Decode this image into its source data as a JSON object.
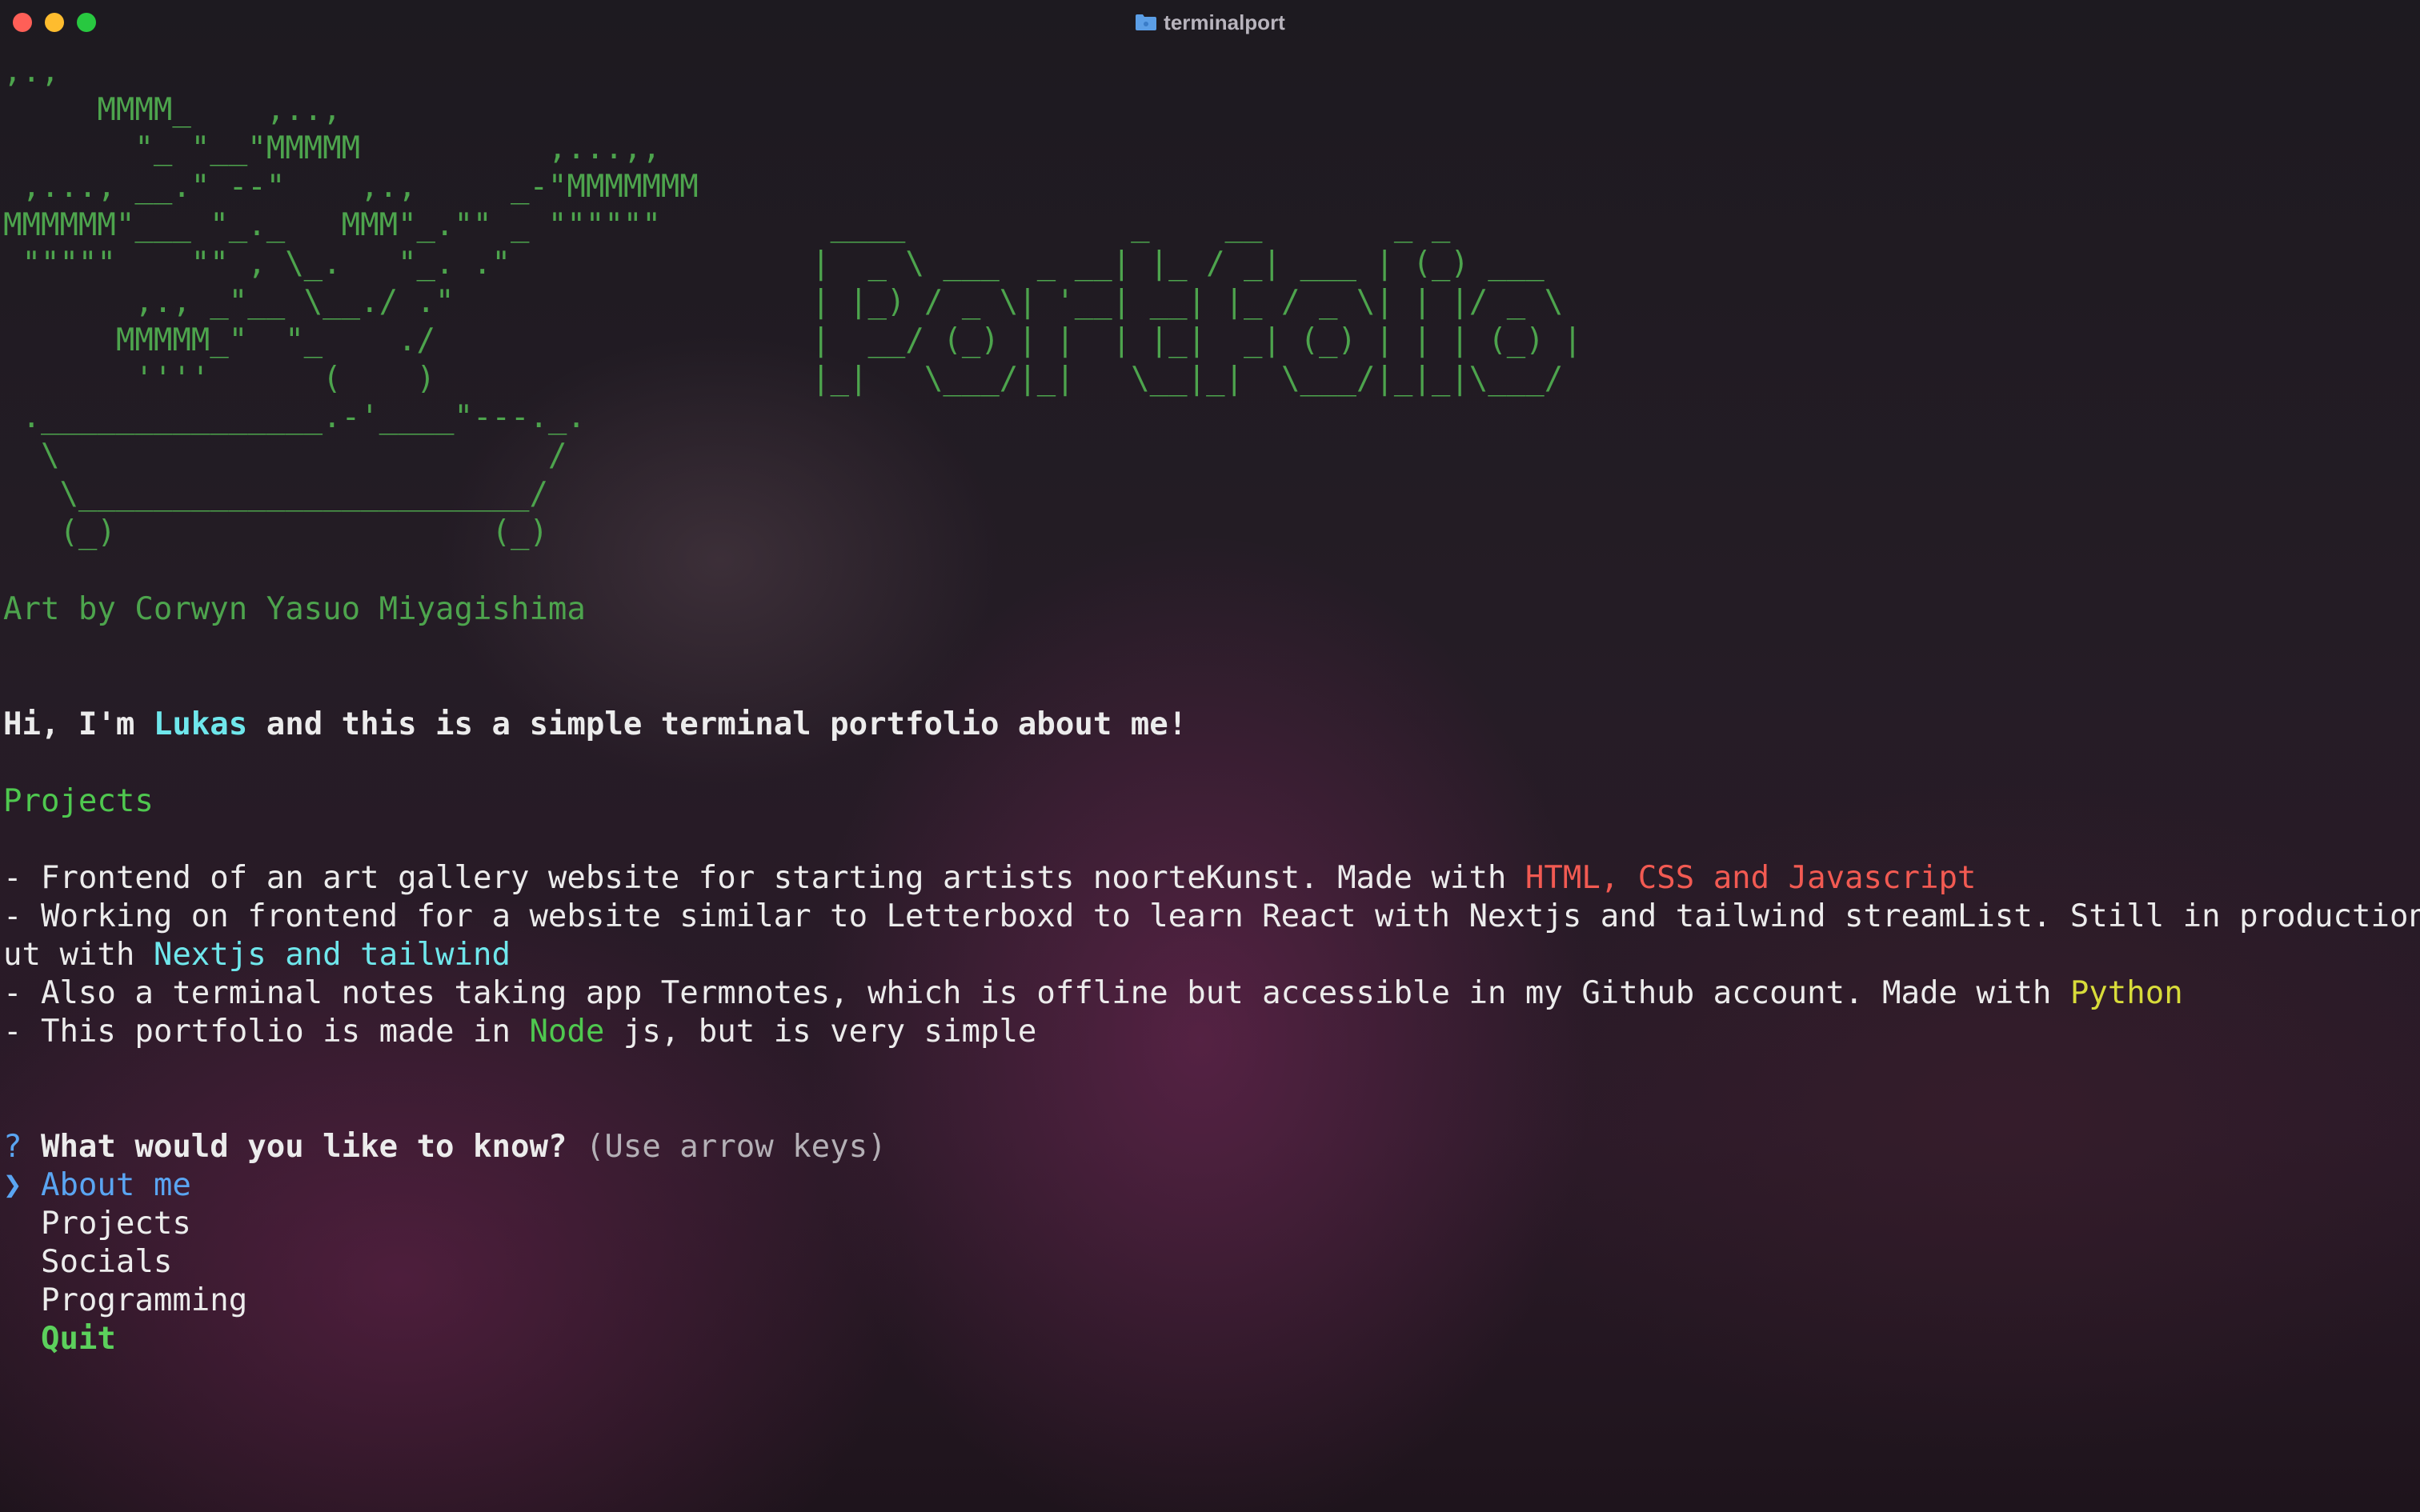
{
  "window": {
    "title": "terminalport",
    "folder_icon": "folder-icon"
  },
  "art": {
    "lines": [
      ",.,",
      "     MMMM_    ,..,",
      "       \"_ \"__\"MMMMM          ,...,,",
      " ,..., __.\" --\"    ,.,     _-\"MMMMMMM",
      "MMMMMM\"___ \"_._   MMM\"_.\"\" _ \"\"\"\"\"\"",
      " \"\"\"\"\"    \"\" , \\_.   \"_. .\"",
      "       ,., _\"__ \\__./ .\"",
      "      MMMMM_\"  \"_    ./",
      "       ''''      (    )",
      " ._______________.-'____\"---._.",
      "  \\                          /",
      "   \\________________________/",
      "   (_)                    (_)"
    ],
    "credit": "Art by Corwyn Yasuo Miyagishima"
  },
  "logo": {
    "lines": [
      " ____            _    __       _ _",
      "|  _ \\ ___  _ __| |_ / _| ___ | (_) ___",
      "| |_) / _ \\| '__| __| |_ / _ \\| | |/ _ \\",
      "|  __/ (_) | |  | |_|  _| (_) | | | (_) |",
      "|_|   \\___/|_|   \\__|_|  \\___/|_|_|\\___/"
    ]
  },
  "intro": {
    "pre": "Hi, I'm ",
    "name": "Lukas",
    "post": " and this is a simple terminal portfolio about me!"
  },
  "projects": {
    "heading": "Projects",
    "item1": {
      "text": "- Frontend of an art gallery website for starting artists noorteKunst. Made with ",
      "tech": "HTML, CSS and Javascript"
    },
    "item2": {
      "line1": "- Working on frontend for a website similar to Letterboxd to learn React with Nextjs and tailwind streamList. Still in production b",
      "line2_pre": "ut with ",
      "tech": "Nextjs and tailwind"
    },
    "item3": {
      "text": "- Also a terminal notes taking app Termnotes, which is offline but accessible in my Github account. Made with ",
      "tech": "Python"
    },
    "item4": {
      "pre": "- This portfolio is made in ",
      "tech": "Node",
      "post": " js, but is very simple"
    }
  },
  "prompt": {
    "mark": "?",
    "question": "What would you like to know?",
    "hint": "(Use arrow keys)",
    "pointer": "❯",
    "options": [
      "About me",
      "Projects",
      "Socials",
      "Programming",
      "Quit"
    ],
    "selected_index": 0
  },
  "colors": {
    "art": "#4da44d",
    "name": "#6fe7ec",
    "tech_web": "#f25a52",
    "tech_next": "#6fe7ec",
    "tech_python": "#d8dc3a",
    "tech_node": "#4fc84f",
    "selected_option": "#5aa5f2",
    "quit": "#5cd05c"
  }
}
